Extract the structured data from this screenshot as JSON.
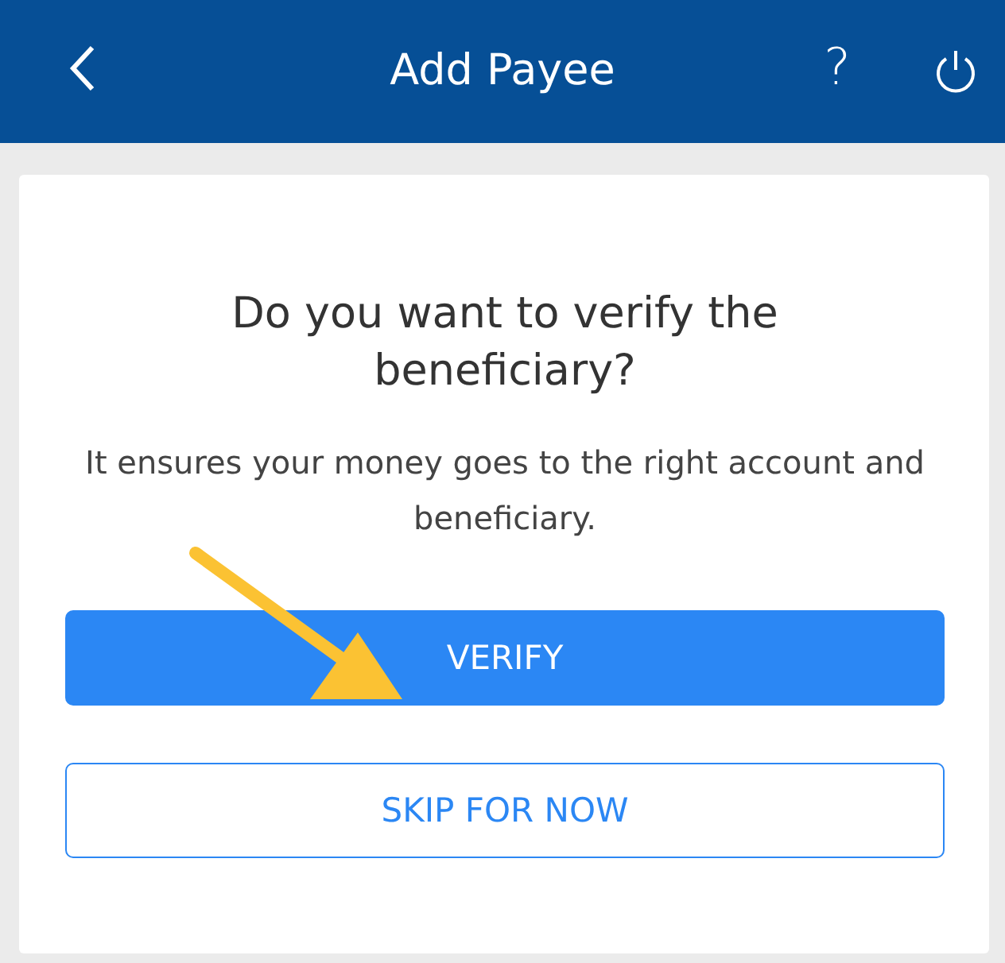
{
  "header": {
    "title": "Add Payee",
    "help": "?"
  },
  "dialog": {
    "title": "Do you want to verify the beneficiary?",
    "message": "It ensures your money goes to the right account and beneficiary.",
    "buttons": [
      {
        "label": "VERIFY",
        "kind": "primary"
      },
      {
        "label": "SKIP FOR NOW",
        "kind": "secondary"
      }
    ]
  }
}
